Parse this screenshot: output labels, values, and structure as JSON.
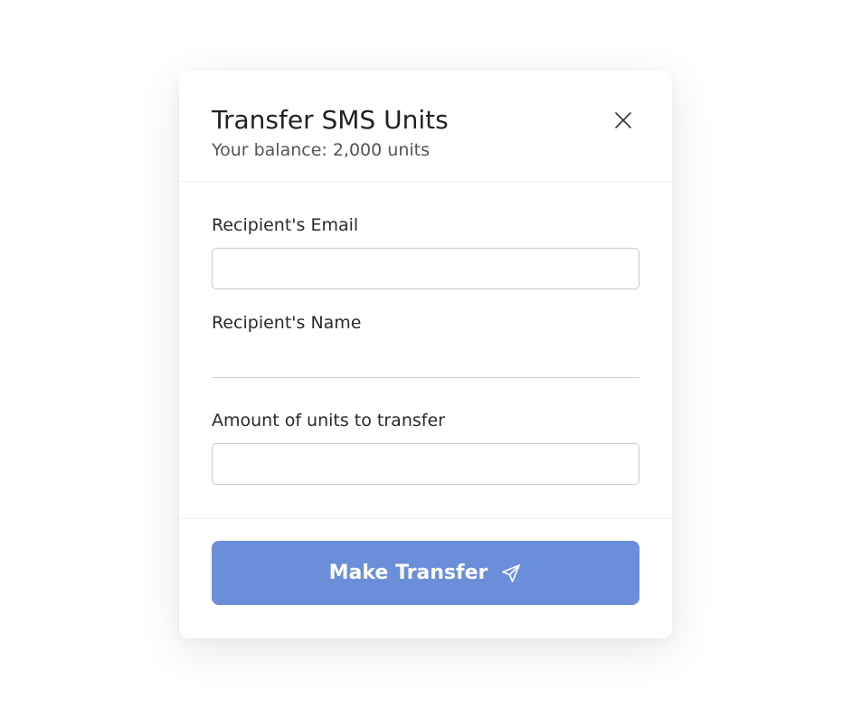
{
  "modal": {
    "title": "Transfer SMS Units",
    "balance": "Your balance: 2,000 units",
    "close_icon": "close-icon"
  },
  "form": {
    "email_label": "Recipient's Email",
    "email_value": "",
    "email_placeholder": "",
    "name_label": "Recipient's Name",
    "name_value": "",
    "name_placeholder": "",
    "amount_label": "Amount of units to transfer",
    "amount_value": "",
    "amount_placeholder": ""
  },
  "submit": {
    "label": "Make Transfer",
    "icon": "send-icon"
  },
  "colors": {
    "primary": "#6a8ed9",
    "text": "#222222",
    "muted": "#555555",
    "border": "#c9c9c9"
  }
}
